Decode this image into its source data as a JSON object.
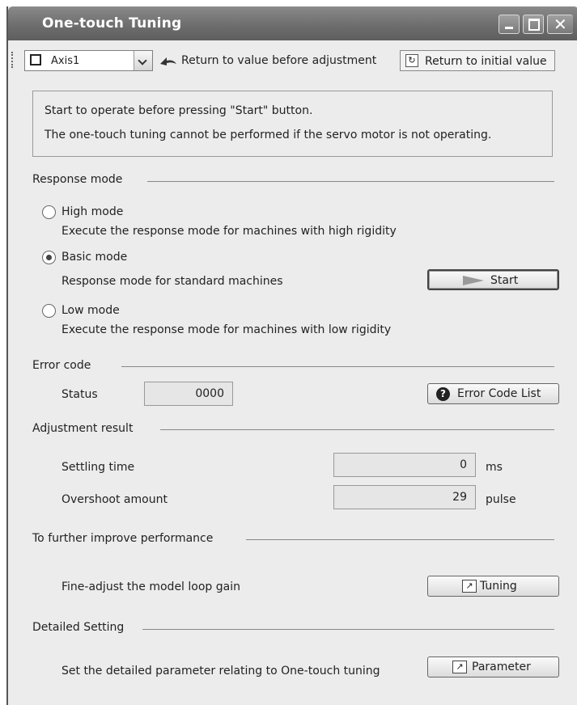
{
  "window": {
    "title": "One-touch Tuning",
    "close_glyph": "✕"
  },
  "toolbar": {
    "axis_value": "Axis1",
    "return_adjust_label": "Return to value before adjustment",
    "return_initial_label": "Return to initial value"
  },
  "notice": {
    "line1": "Start to operate before pressing \"Start\" button.",
    "line2": "The one-touch tuning cannot be performed if the servo motor is not operating."
  },
  "response_mode": {
    "heading": "Response mode",
    "selected": "Basic mode",
    "high": {
      "label": "High mode",
      "desc": "Execute the response mode for machines with high rigidity"
    },
    "basic": {
      "label": "Basic mode",
      "desc": "Response mode for standard machines"
    },
    "low": {
      "label": "Low mode",
      "desc": "Execute the response mode for machines with low rigidity"
    },
    "start_label": "Start"
  },
  "error_code": {
    "heading": "Error code",
    "status_label": "Status",
    "status_value": "0000",
    "list_label": "Error Code List"
  },
  "adjustment_result": {
    "heading": "Adjustment result",
    "settling_label": "Settling time",
    "settling_value": "0",
    "settling_unit": "ms",
    "overshoot_label": "Overshoot amount",
    "overshoot_value": "29",
    "overshoot_unit": "pulse"
  },
  "improve": {
    "heading": "To further improve performance",
    "desc": "Fine-adjust the model loop gain",
    "button_label": "Tuning"
  },
  "detailed": {
    "heading": "Detailed Setting",
    "desc": "Set the detailed parameter relating to One-touch tuning",
    "button_label": "Parameter"
  },
  "icons": {
    "window-icon": "none",
    "minimize": "minimize-icon",
    "maximize": "maximize-icon",
    "close": "close-icon",
    "return": "undo-arrow-icon",
    "initial": "reset-icon",
    "start": "play-icon",
    "error_list": "question-icon",
    "link": "external-link-icon"
  }
}
